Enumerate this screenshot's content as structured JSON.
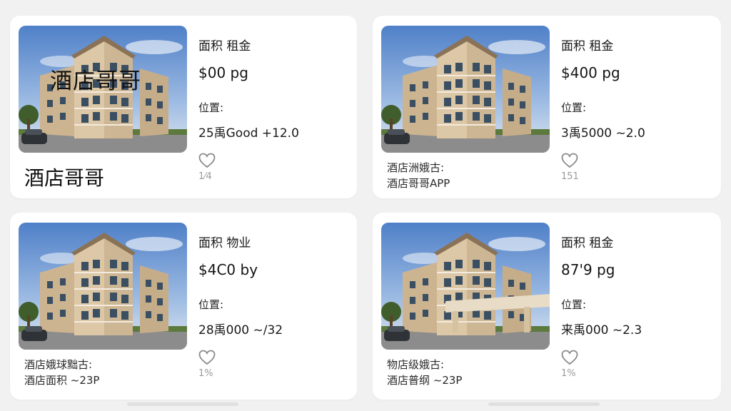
{
  "listings": [
    {
      "area_label": "面积 租金",
      "price": "$00 pg",
      "location_label": "位置:",
      "location_value": "25禹Good +12.0",
      "overlay_text": "酒店哥哥",
      "caption_big": "酒店哥哥",
      "likes": "1⁄4"
    },
    {
      "area_label": "面积 租金",
      "price": "$400 pg",
      "location_label": "位置:",
      "location_value": "3禹5000 ~2.0",
      "caption_line1": "酒店洲娥古:",
      "caption_line2": "酒店哥哥APP",
      "likes": "151"
    },
    {
      "area_label": "面积 物业",
      "price": "$4C0 by",
      "location_label": "位置:",
      "location_value": "28禹000 ~/32",
      "caption_line1": "酒店娥球黜古:",
      "caption_line2": "酒店面积 ~23P",
      "likes": "1%"
    },
    {
      "area_label": "面积 租金",
      "price": "87'9 pg",
      "location_label": "位置:",
      "location_value": "来禹000 ~2.3",
      "caption_line1": "物店级娥古:",
      "caption_line2": "酒店普纲 ~23P",
      "likes": "1%"
    }
  ],
  "icons": {
    "like": "heart-outline-icon"
  },
  "colors": {
    "background": "#f1f1f1",
    "card": "#ffffff",
    "heart_stroke": "#8a8a8a",
    "sky": "#5f8fd0",
    "building": "#d8c3a2"
  }
}
